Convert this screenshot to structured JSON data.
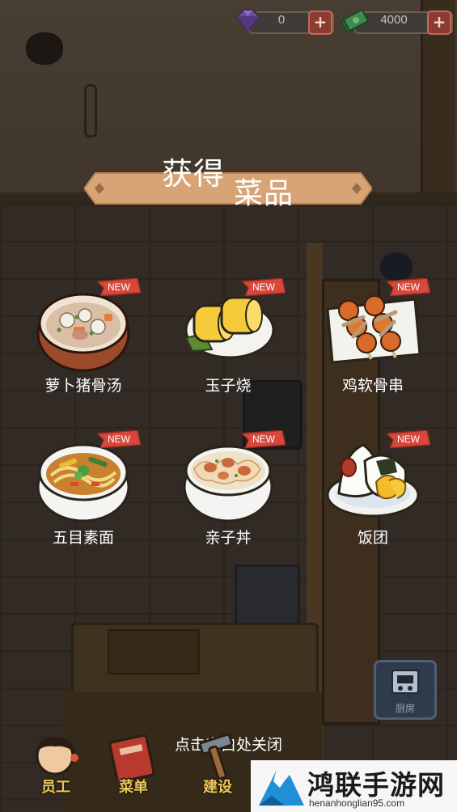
{
  "resources": {
    "gems": {
      "icon": "purple-gem-icon",
      "value": "0",
      "plus": "+"
    },
    "cash": {
      "icon": "cash-stack-icon",
      "value": "4000",
      "plus": "+"
    }
  },
  "banner": {
    "title_part1": "获得",
    "title_part2": "菜品",
    "color": "#d9a679"
  },
  "new_tag": "NEW",
  "dishes": [
    {
      "name": "萝卜猪骨汤",
      "icon": "radish-pork-bone-soup-icon",
      "is_new": true
    },
    {
      "name": "玉子烧",
      "icon": "tamagoyaki-icon",
      "is_new": true
    },
    {
      "name": "鸡软骨串",
      "icon": "chicken-cartilage-skewer-icon",
      "is_new": true
    },
    {
      "name": "五目素面",
      "icon": "gomoku-somen-icon",
      "is_new": true
    },
    {
      "name": "亲子丼",
      "icon": "oyakodon-icon",
      "is_new": true
    },
    {
      "name": "饭团",
      "icon": "onigiri-icon",
      "is_new": true
    }
  ],
  "close_hint": "点击空白处关闭",
  "kitchen_button": {
    "label": "厨房",
    "icon": "stove-icon"
  },
  "bottom_tabs": [
    {
      "label": "员工",
      "icon": "staff-chef-icon"
    },
    {
      "label": "菜单",
      "icon": "menu-book-icon"
    },
    {
      "label": "建设",
      "icon": "hammer-icon"
    }
  ],
  "watermark": {
    "title": "鸿联手游网",
    "url": "henanhonglian95.com"
  }
}
